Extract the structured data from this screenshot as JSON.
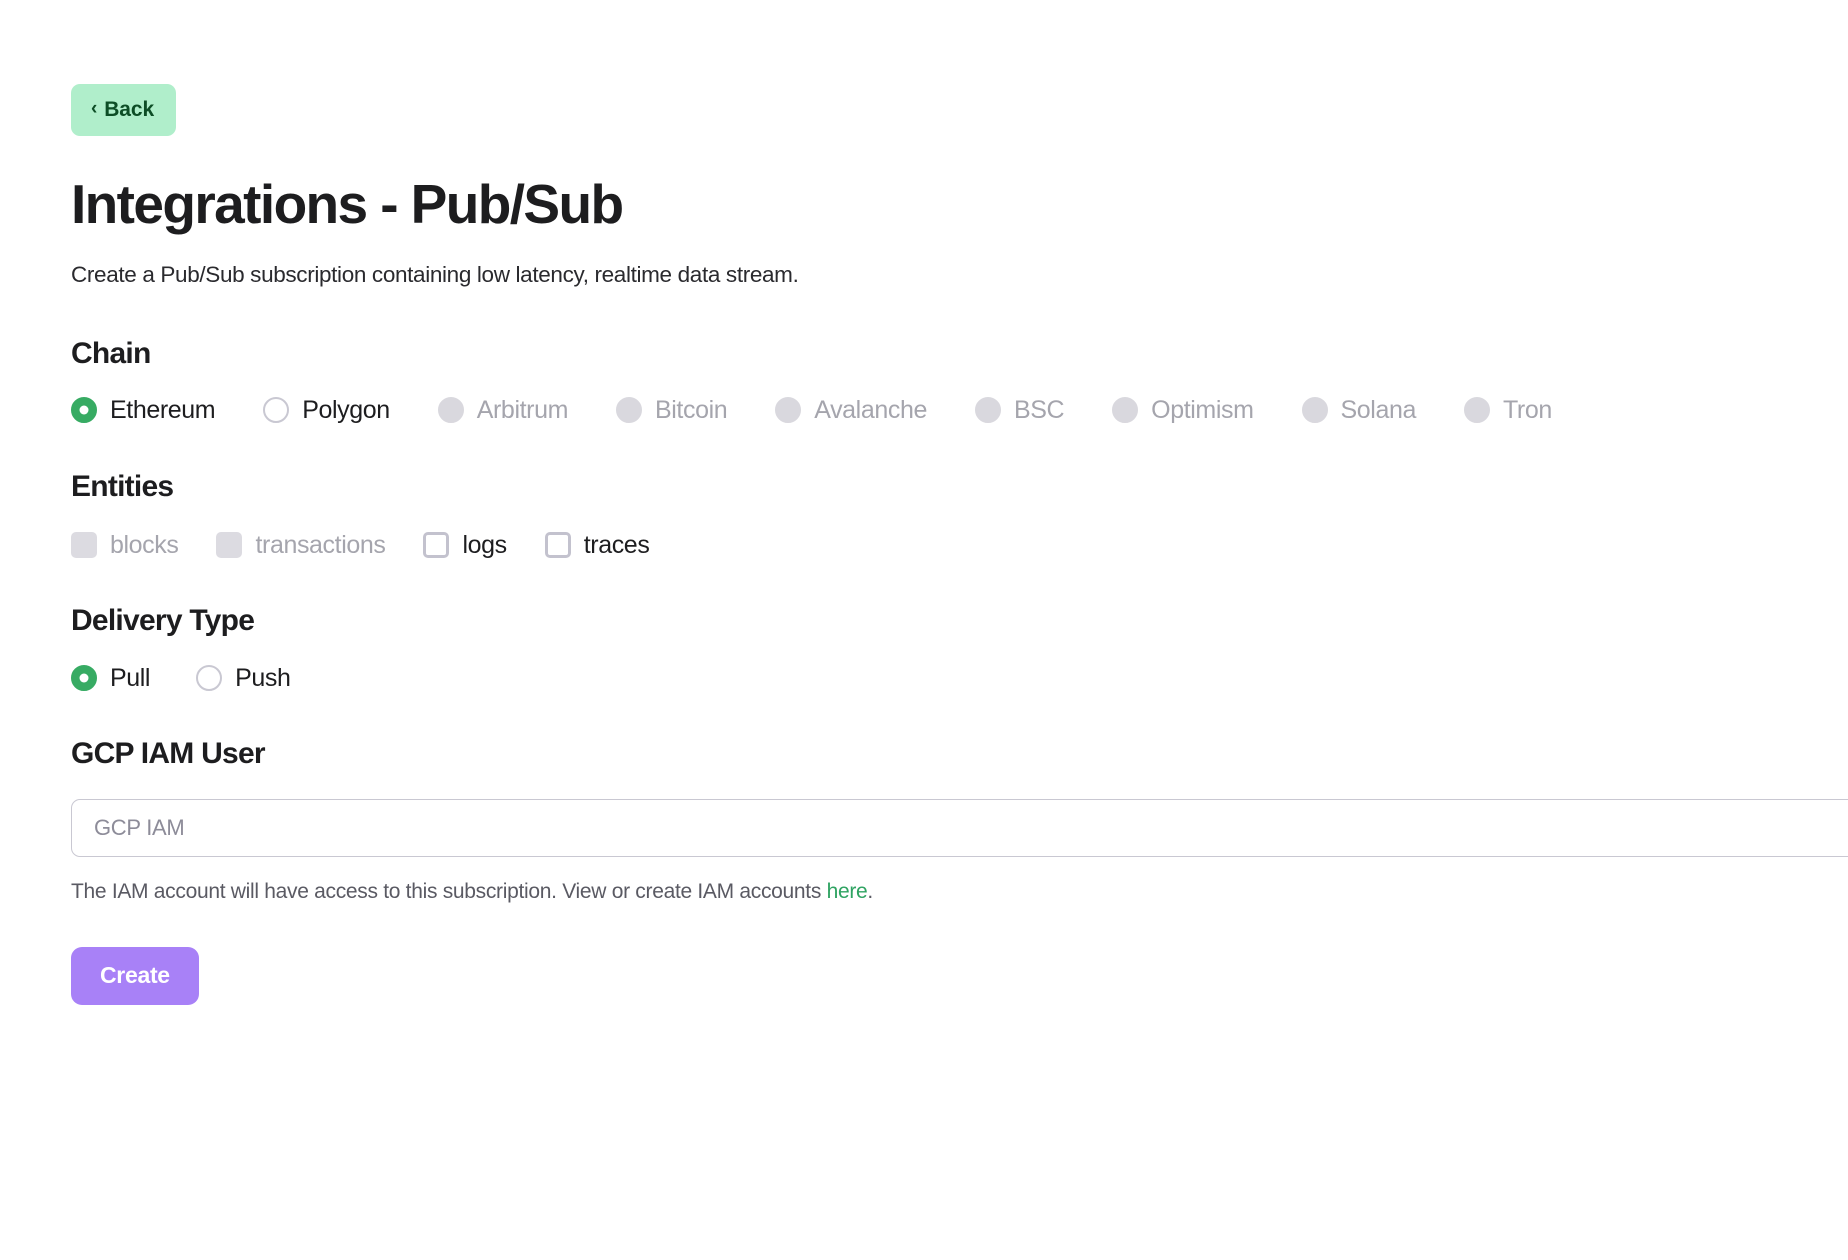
{
  "nav": {
    "back_label": "Back",
    "back_chevron": "chevron-left-icon",
    "back_chevron_glyph": "‹"
  },
  "header": {
    "title": "Integrations - Pub/Sub",
    "subtitle": "Create a Pub/Sub subscription containing low latency, realtime data stream."
  },
  "chain": {
    "heading": "Chain",
    "options": [
      {
        "label": "Ethereum",
        "state": "selected"
      },
      {
        "label": "Polygon",
        "state": "unselected"
      },
      {
        "label": "Arbitrum",
        "state": "disabled"
      },
      {
        "label": "Bitcoin",
        "state": "disabled"
      },
      {
        "label": "Avalanche",
        "state": "disabled"
      },
      {
        "label": "BSC",
        "state": "disabled"
      },
      {
        "label": "Optimism",
        "state": "disabled"
      },
      {
        "label": "Solana",
        "state": "disabled"
      },
      {
        "label": "Tron",
        "state": "disabled"
      }
    ]
  },
  "entities": {
    "heading": "Entities",
    "options": [
      {
        "label": "blocks",
        "state": "disabled"
      },
      {
        "label": "transactions",
        "state": "disabled"
      },
      {
        "label": "logs",
        "state": "unchecked"
      },
      {
        "label": "traces",
        "state": "unchecked"
      }
    ]
  },
  "delivery": {
    "heading": "Delivery Type",
    "options": [
      {
        "label": "Pull",
        "state": "selected"
      },
      {
        "label": "Push",
        "state": "unselected"
      }
    ]
  },
  "gcp": {
    "heading": "GCP IAM User",
    "input_value": "",
    "input_placeholder": "GCP IAM",
    "helper_text": "The IAM account will have access to this subscription. View or create IAM accounts ",
    "helper_link": "here",
    "helper_suffix": "."
  },
  "actions": {
    "create_label": "Create"
  },
  "colors": {
    "back_bg": "#b0eecb",
    "back_text": "#0d4d26",
    "radio_selected": "#37ab63",
    "radio_border": "#c9c8d2",
    "disabled_fill": "#d9d8de",
    "disabled_text": "#a5a5ad",
    "checkbox_border": "#c3c2ce",
    "link_green": "#2fa362",
    "create_bg": "#a881f7",
    "create_text": "#ffffff",
    "title_text": "#1d1d1f",
    "helper_text": "#5a5a63"
  }
}
